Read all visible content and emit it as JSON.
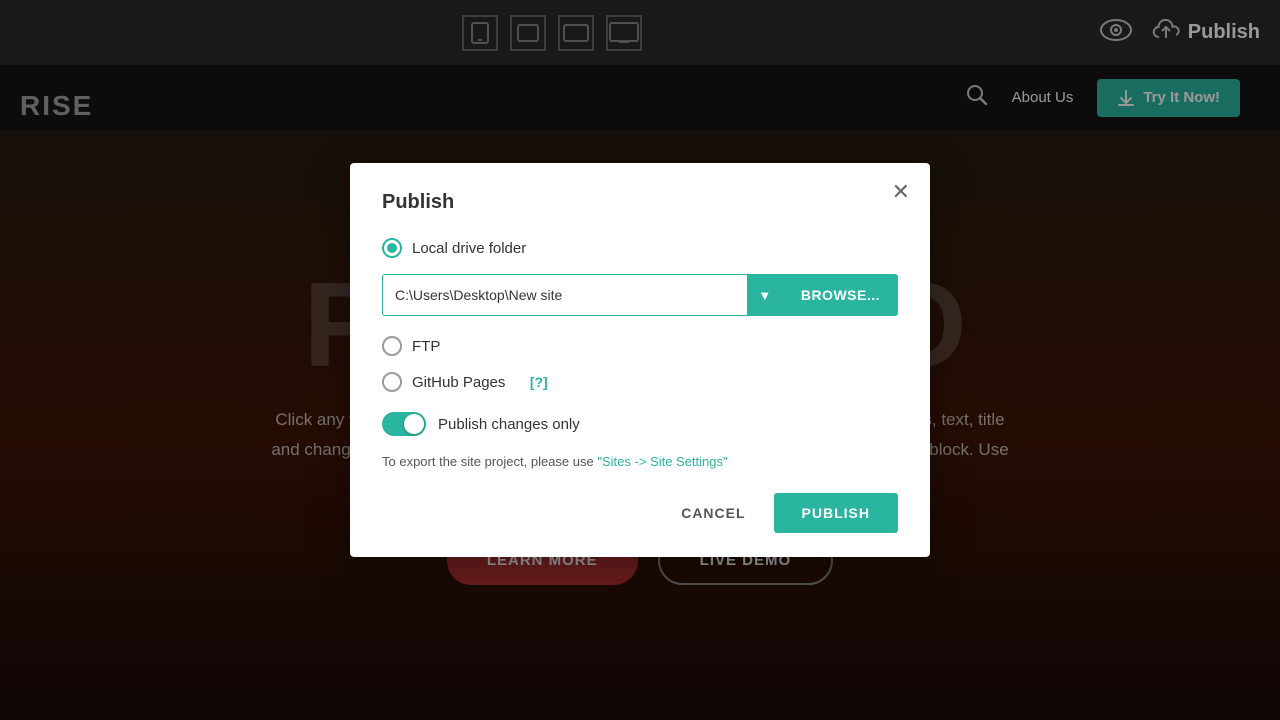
{
  "toolbar": {
    "publish_label": "Publish",
    "eye_icon": "👁",
    "cloud_icon": "☁"
  },
  "navbar": {
    "search_icon": "🔍",
    "about_label": "About Us",
    "cta_label": "Try It Now!",
    "cta_icon": "⬇"
  },
  "brand": {
    "text": "RISE"
  },
  "hero": {
    "title": "FU          O",
    "body_text": "Click any text to edit it. Click the \"Gear\" icon in the top right corner to hide/show buttons, text, title and change the block background. Click red \"+\" in the bottom right corner to add a new block. Use the top left menu to create new pages, sites and add themes.",
    "learn_more": "LEARN MORE",
    "live_demo": "LIVE DEMO"
  },
  "modal": {
    "title": "Publish",
    "close_icon": "✕",
    "local_drive_label": "Local drive folder",
    "path_value": "C:\\Users\\Desktop\\New site",
    "path_placeholder": "C:\\Users\\Desktop\\New site",
    "dropdown_icon": "▼",
    "browse_label": "BROWSE...",
    "ftp_label": "FTP",
    "github_label": "GitHub Pages",
    "github_help": "[?]",
    "toggle_label": "Publish changes only",
    "export_note_prefix": "To export the site project, please use ",
    "export_link_text": "\"Sites -> Site Settings\"",
    "cancel_label": "CANCEL",
    "publish_label": "PUBLISH"
  },
  "colors": {
    "teal": "#2ab5a0",
    "red_btn": "#b03030"
  }
}
